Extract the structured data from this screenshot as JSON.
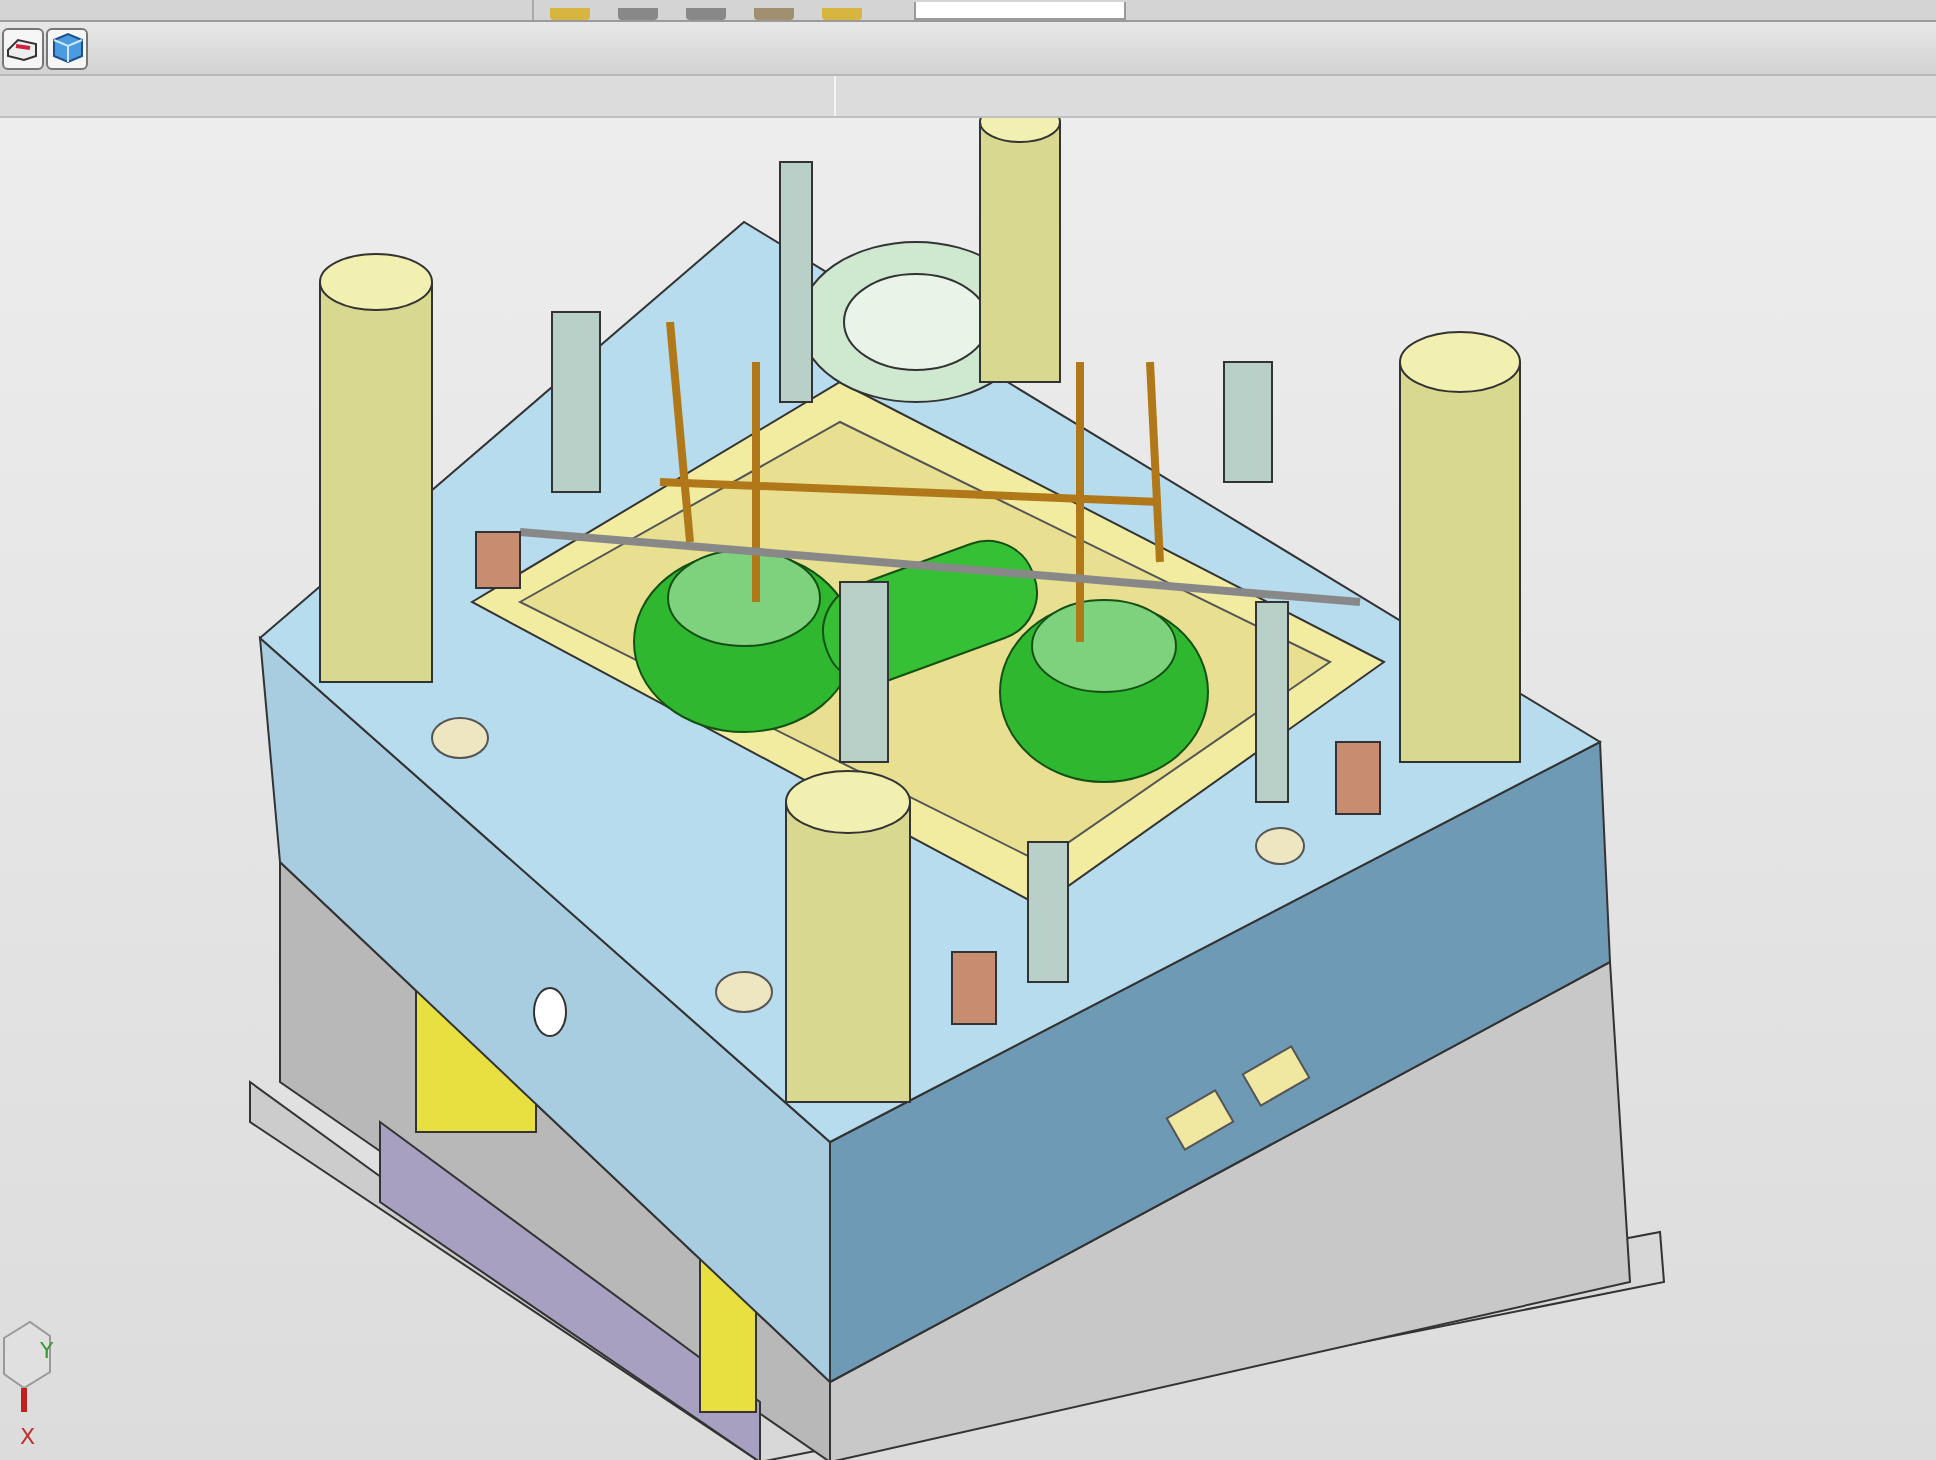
{
  "view_triad": {
    "x_label": "X",
    "y_label": "Y"
  }
}
